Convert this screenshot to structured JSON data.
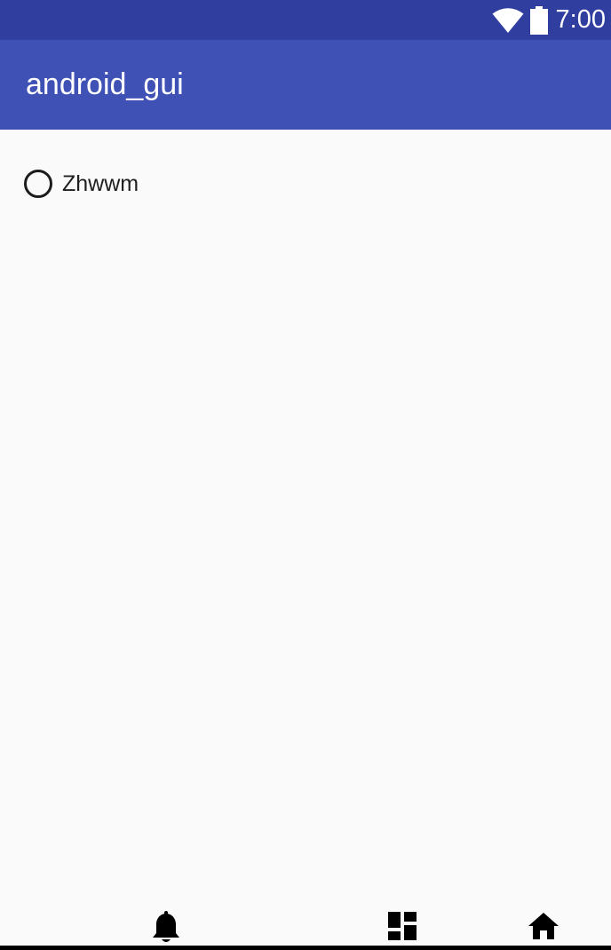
{
  "status_bar": {
    "time": "7:00",
    "icons": [
      "wifi-icon",
      "battery-icon"
    ]
  },
  "app_bar": {
    "title": "android_gui"
  },
  "main": {
    "radio_options": [
      {
        "label": "Zhwwm",
        "selected": false
      }
    ]
  },
  "bottom_nav": {
    "icons": [
      "bell-icon",
      "dashboard-icon",
      "home-icon"
    ]
  },
  "colors": {
    "status_bar": "#303f9f",
    "app_bar": "#3f51b5",
    "background": "#fafafa"
  }
}
